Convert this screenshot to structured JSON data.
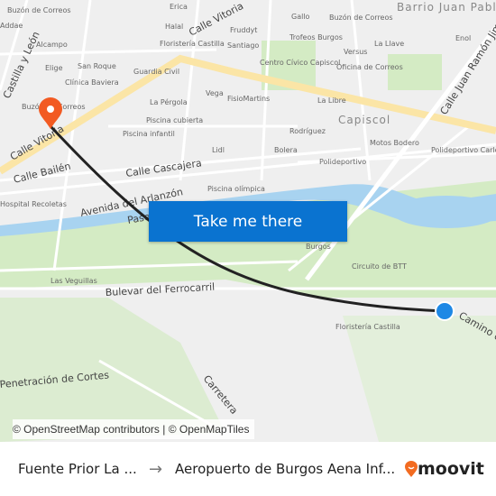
{
  "map": {
    "labels": [
      "Buzón de Correos",
      "Addae",
      "Alcampo",
      "Elige",
      "San Roque",
      "Clínica Baviera",
      "Buzón de Correos",
      "Halal",
      "Floristería Castilla",
      "Fruddyt",
      "Santiago",
      "Guardia Civil",
      "La Pérgola",
      "Vega",
      "FisioMartins",
      "Piscina cubierta",
      "Piscina infantil",
      "Lidl",
      "Piscina olímpica",
      "Hospital Recoletas",
      "Gallo",
      "Buzón de Correos",
      "Trofeos Burgos",
      "La Llave",
      "Versus",
      "Centro Cívico Capiscol",
      "Oficina de Correos",
      "Enol",
      "La Libre",
      "Rodríguez",
      "Bolera",
      "Motos Bodero",
      "Polideportivo",
      "Polideportivo Carlos Serna",
      "Burgos",
      "Circuito de BTT",
      "Las Veguillas",
      "Floristería Castilla",
      "Erica"
    ],
    "roads": [
      "Calle Vitoria",
      "Calle Vitoria",
      "Calle Bailén",
      "Calle Cascajera",
      "Avenida del Arlanzón",
      "Paseo",
      "Bulevar del Ferrocarril",
      "Calle Juan Ramón Jiménez",
      "Camino de",
      "Carretera",
      "Penetración de Cortes",
      "Castilla y León"
    ],
    "districts": [
      "Capiscol",
      "Barrio Juan Pablo II"
    ],
    "colors": {
      "water": "#a8d3f0",
      "park": "#d4ebc4",
      "road_major": "#fbe5a6",
      "route": "#222222",
      "origin": "#f25a22",
      "destination": "#1e88e5"
    }
  },
  "cta": {
    "label": "Take me there"
  },
  "attribution": "© OpenStreetMap contributors | © OpenMapTiles",
  "footer": {
    "from": "Fuente Prior La ...",
    "arrow": "→",
    "to": "Aeropuerto de Burgos Aena Inf...",
    "brand": "moovit"
  }
}
